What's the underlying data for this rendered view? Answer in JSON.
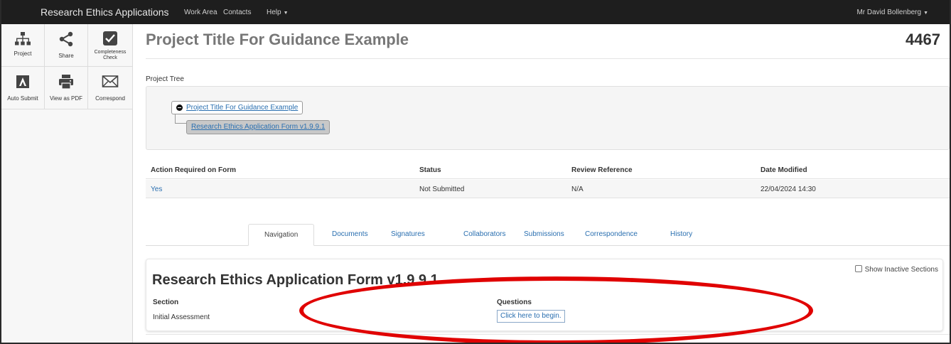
{
  "navbar": {
    "brand": "Research Ethics Applications",
    "links": [
      "Work Area",
      "Contacts",
      "Help"
    ],
    "user": "Mr David Bollenberg"
  },
  "toolbar": {
    "items": [
      {
        "label": "Project",
        "icon": "sitemap-icon"
      },
      {
        "label": "Share",
        "icon": "share-icon"
      },
      {
        "label": "Completeness Check",
        "icon": "checkbox-icon"
      },
      {
        "label": "Auto Submit",
        "icon": "auto-submit-icon"
      },
      {
        "label": "View as PDF",
        "icon": "printer-icon"
      },
      {
        "label": "Correspond",
        "icon": "envelope-icon"
      }
    ]
  },
  "header": {
    "title": "Project Title For Guidance Example",
    "project_id": "4467"
  },
  "tree": {
    "label": "Project Tree",
    "root": "Project Title For Guidance Example",
    "child": "Research Ethics Application Form v1.9.9.1"
  },
  "info_table": {
    "headers": [
      "Action Required on Form",
      "Status",
      "Review Reference",
      "Date Modified"
    ],
    "row": [
      "Yes",
      "Not Submitted",
      "N/A",
      "22/04/2024 14:30"
    ]
  },
  "tabs": [
    "Navigation",
    "Documents",
    "Signatures",
    "Collaborators",
    "Submissions",
    "Correspondence",
    "History"
  ],
  "form": {
    "title": "Research Ethics Application Form v1.9.9.1",
    "inactive_label": "Show Inactive Sections",
    "section_header": "Section",
    "questions_header": "Questions",
    "section_value": "Initial Assessment",
    "begin_label": "Click here to begin."
  },
  "colors": {
    "navbar": "#1e1e1e",
    "link": "#2a6fb0",
    "annotation": "#e00000"
  }
}
